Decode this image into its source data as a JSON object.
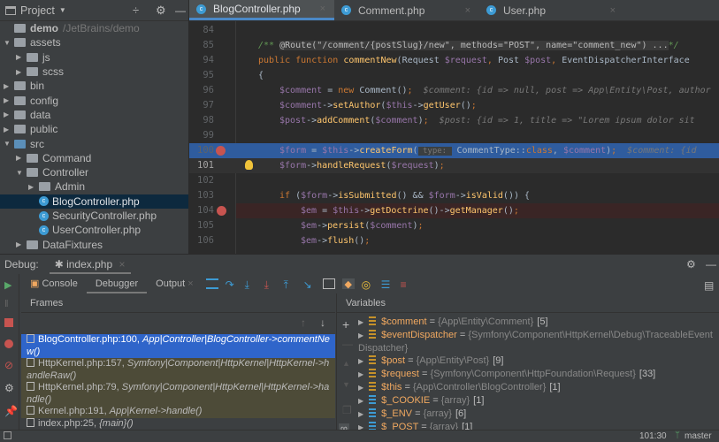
{
  "sidebar": {
    "title": "Project",
    "items": [
      {
        "label": "demo",
        "path": "/JetBrains/demo",
        "depth": 0,
        "type": "root"
      },
      {
        "label": "assets",
        "depth": 0,
        "type": "folder",
        "open": true
      },
      {
        "label": "js",
        "depth": 1,
        "type": "folder"
      },
      {
        "label": "scss",
        "depth": 1,
        "type": "folder"
      },
      {
        "label": "bin",
        "depth": 0,
        "type": "folder"
      },
      {
        "label": "config",
        "depth": 0,
        "type": "folder"
      },
      {
        "label": "data",
        "depth": 0,
        "type": "folder"
      },
      {
        "label": "public",
        "depth": 0,
        "type": "folder"
      },
      {
        "label": "src",
        "depth": 0,
        "type": "folder",
        "open": true,
        "blue": true
      },
      {
        "label": "Command",
        "depth": 1,
        "type": "folder"
      },
      {
        "label": "Controller",
        "depth": 1,
        "type": "folder",
        "open": true
      },
      {
        "label": "Admin",
        "depth": 2,
        "type": "folder"
      },
      {
        "label": "BlogController.php",
        "depth": 2,
        "type": "file",
        "selected": true
      },
      {
        "label": "SecurityController.php",
        "depth": 2,
        "type": "file"
      },
      {
        "label": "UserController.php",
        "depth": 2,
        "type": "file"
      },
      {
        "label": "DataFixtures",
        "depth": 1,
        "type": "folder"
      }
    ]
  },
  "tabs": [
    {
      "label": "BlogController.php",
      "active": true
    },
    {
      "label": "Comment.php"
    },
    {
      "label": "User.php"
    }
  ],
  "editor": {
    "lines": [
      {
        "n": "84",
        "t": []
      },
      {
        "n": "85",
        "t": [
          [
            "cm",
            "/** "
          ],
          [
            "anno",
            "@Route(\"/comment/{postSlug}/new\", methods=\"POST\", name=\"comment_new\") ..."
          ],
          [
            "cm",
            "*/"
          ]
        ]
      },
      {
        "n": "94",
        "t": [
          [
            "kw",
            "public function "
          ],
          [
            "fn",
            "commentNew"
          ],
          [
            "pl",
            "(Request "
          ],
          [
            "var",
            "$request"
          ],
          [
            "kw",
            ", "
          ],
          [
            "pl",
            "Post "
          ],
          [
            "var",
            "$post"
          ],
          [
            "kw",
            ", "
          ],
          [
            "pl",
            "EventDispatcherInterface"
          ]
        ]
      },
      {
        "n": "95",
        "t": [
          [
            "pl",
            "{"
          ]
        ]
      },
      {
        "n": "96",
        "i": 1,
        "t": [
          [
            "var",
            "$comment"
          ],
          [
            "pl",
            " = "
          ],
          [
            "kw",
            "new "
          ],
          [
            "pl",
            "Comment()"
          ],
          [
            "kw",
            ";"
          ],
          [
            "hint",
            "  $comment: {id => null, post => App\\Entity\\Post, author"
          ]
        ]
      },
      {
        "n": "97",
        "i": 1,
        "t": [
          [
            "var",
            "$comment"
          ],
          [
            "pl",
            "->"
          ],
          [
            "fn",
            "setAuthor"
          ],
          [
            "pl",
            "("
          ],
          [
            "var",
            "$this"
          ],
          [
            "pl",
            "->"
          ],
          [
            "fn",
            "getUser"
          ],
          [
            "pl",
            "()"
          ],
          [
            "kw",
            ";"
          ]
        ]
      },
      {
        "n": "98",
        "i": 1,
        "t": [
          [
            "var",
            "$post"
          ],
          [
            "pl",
            "->"
          ],
          [
            "fn",
            "addComment"
          ],
          [
            "pl",
            "("
          ],
          [
            "var",
            "$comment"
          ],
          [
            "pl",
            ")"
          ],
          [
            "kw",
            ";"
          ],
          [
            "hint",
            "  $post: {id => 1, title => \"Lorem ipsum dolor sit"
          ]
        ]
      },
      {
        "n": "99",
        "t": []
      },
      {
        "n": "100",
        "i": 1,
        "exec": true,
        "bp": true,
        "t": [
          [
            "var",
            "$form"
          ],
          [
            "pl",
            " = "
          ],
          [
            "var",
            "$this"
          ],
          [
            "pl",
            "->"
          ],
          [
            "fn",
            "createForm"
          ],
          [
            "pl",
            "("
          ],
          [
            "ph",
            " type: "
          ],
          [
            "pl",
            " CommentType::"
          ],
          [
            "kw",
            "class"
          ],
          [
            "pl",
            ", "
          ],
          [
            "var",
            "$comment"
          ],
          [
            "pl",
            ")"
          ],
          [
            "kw",
            ";"
          ],
          [
            "hint",
            "  $comment: {id"
          ]
        ]
      },
      {
        "n": "101",
        "i": 1,
        "cur": true,
        "bulb": true,
        "t": [
          [
            "var",
            "$form"
          ],
          [
            "pl",
            "->"
          ],
          [
            "fn",
            "handleRequest"
          ],
          [
            "pl",
            "("
          ],
          [
            "var",
            "$request"
          ],
          [
            "pl",
            ")"
          ],
          [
            "kw",
            ";"
          ]
        ]
      },
      {
        "n": "102",
        "t": []
      },
      {
        "n": "103",
        "i": 1,
        "t": [
          [
            "kw",
            "if "
          ],
          [
            "pl",
            "("
          ],
          [
            "var",
            "$form"
          ],
          [
            "pl",
            "->"
          ],
          [
            "fn",
            "isSubmitted"
          ],
          [
            "pl",
            "() && "
          ],
          [
            "var",
            "$form"
          ],
          [
            "pl",
            "->"
          ],
          [
            "fn",
            "isValid"
          ],
          [
            "pl",
            "()) {"
          ]
        ]
      },
      {
        "n": "104",
        "i": 2,
        "bp": true,
        "bpline": true,
        "t": [
          [
            "var",
            "$em"
          ],
          [
            "pl",
            " = "
          ],
          [
            "var",
            "$this"
          ],
          [
            "pl",
            "->"
          ],
          [
            "fn",
            "getDoctrine"
          ],
          [
            "pl",
            "()->"
          ],
          [
            "fn",
            "getManager"
          ],
          [
            "pl",
            "()"
          ],
          [
            "kw",
            ";"
          ]
        ]
      },
      {
        "n": "105",
        "i": 2,
        "t": [
          [
            "var",
            "$em"
          ],
          [
            "pl",
            "->"
          ],
          [
            "fn",
            "persist"
          ],
          [
            "pl",
            "("
          ],
          [
            "var",
            "$comment"
          ],
          [
            "pl",
            ")"
          ],
          [
            "kw",
            ";"
          ]
        ]
      },
      {
        "n": "106",
        "i": 2,
        "t": [
          [
            "var",
            "$em"
          ],
          [
            "pl",
            "->"
          ],
          [
            "fn",
            "flush"
          ],
          [
            "pl",
            "()"
          ],
          [
            "kw",
            ";"
          ]
        ]
      }
    ]
  },
  "debug": {
    "label": "Debug:",
    "session": "index.php",
    "tabs": [
      "Console",
      "Debugger",
      "Output"
    ],
    "active_tab": "Debugger",
    "frames_title": "Frames",
    "variables_title": "Variables",
    "frames": [
      {
        "loc": "BlogController.php:100, ",
        "fn": "App|Controller|BlogController->commentNew()",
        "kind": "sel"
      },
      {
        "loc": "HttpKernel.php:157, ",
        "fn": "Symfony|Component|HttpKernel|HttpKernel->handleRaw()",
        "kind": "lib"
      },
      {
        "loc": "HttpKernel.php:79, ",
        "fn": "Symfony|Component|HttpKernel|HttpKernel->handle()",
        "kind": "lib"
      },
      {
        "loc": "Kernel.php:191, ",
        "fn": "App|Kernel->handle()",
        "kind": "lib"
      },
      {
        "loc": "index.php:25, ",
        "fn": "{main}()",
        "kind": ""
      }
    ],
    "variables": [
      {
        "name": "$comment",
        "type": "{App\\Entity\\Comment}",
        "count": "[5]",
        "icon": "object"
      },
      {
        "name": "$eventDispatcher",
        "type": "{Symfony\\Component\\HttpKernel\\Debug\\TraceableEventDispatcher}",
        "count": "",
        "icon": "object"
      },
      {
        "name": "$post",
        "type": "{App\\Entity\\Post}",
        "count": "[9]",
        "icon": "object"
      },
      {
        "name": "$request",
        "type": "{Symfony\\Component\\HttpFoundation\\Request}",
        "count": "[33]",
        "icon": "object"
      },
      {
        "name": "$this",
        "type": "{App\\Controller\\BlogController}",
        "count": "[1]",
        "icon": "object"
      },
      {
        "name": "$_COOKIE",
        "type": "{array}",
        "count": "[1]",
        "icon": "array"
      },
      {
        "name": "$_ENV",
        "type": "{array}",
        "count": "[6]",
        "icon": "array"
      },
      {
        "name": "$_POST",
        "type": "{array}",
        "count": "[1]",
        "icon": "array"
      }
    ]
  },
  "status": {
    "position": "101:30",
    "branch": "master"
  }
}
